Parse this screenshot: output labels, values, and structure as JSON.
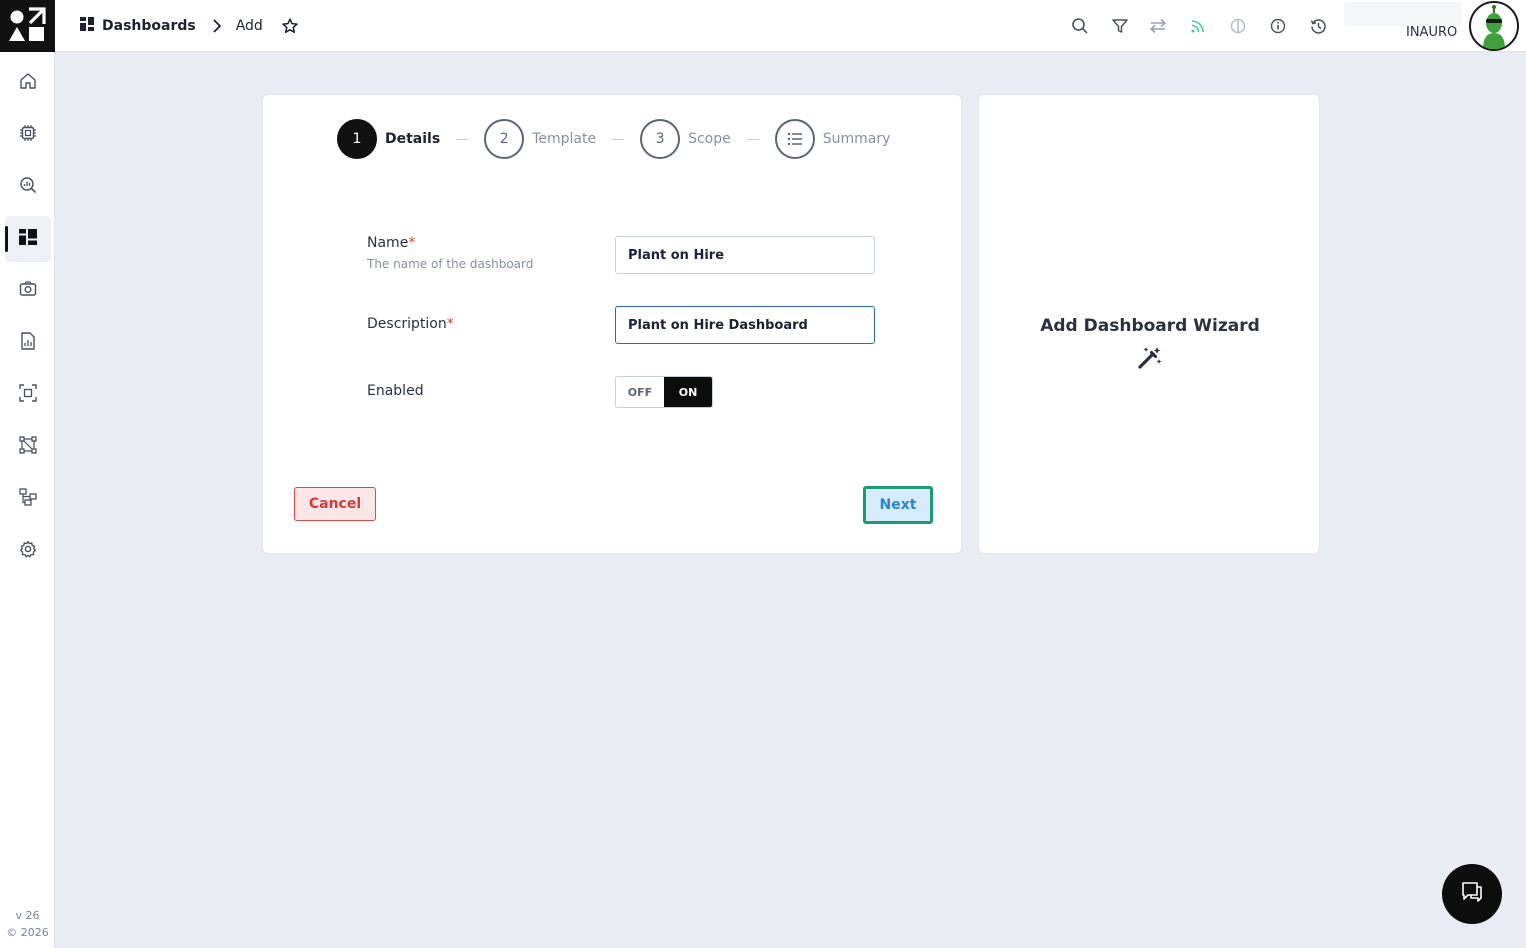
{
  "breadcrumb": {
    "root": "Dashboards",
    "current": "Add"
  },
  "topbar": {
    "tools": [
      "search-icon",
      "filter-icon",
      "swap-icon",
      "feed-icon",
      "theme-icon",
      "info-icon",
      "history-icon"
    ],
    "feed_color": "#3ecf8e",
    "user_name": "INAURO"
  },
  "sidebar": {
    "items": [
      "home-icon",
      "device-icon",
      "explore-icon",
      "dashboards-icon",
      "camera-icon",
      "report-icon",
      "scope-icon",
      "diagram-icon",
      "hierarchy-icon",
      "settings-icon"
    ],
    "active": "dashboards-icon",
    "version": "v 26",
    "copyright": "© 2026"
  },
  "wizard": {
    "steps": [
      {
        "number": "1",
        "label": "Details",
        "active": true
      },
      {
        "number": "2",
        "label": "Template",
        "active": false
      },
      {
        "number": "3",
        "label": "Scope",
        "active": false
      },
      {
        "number": "",
        "label": "Summary",
        "active": false
      }
    ],
    "form": {
      "name_label": "Name",
      "name_hint": "The name of the dashboard",
      "name_value": "Plant on Hire",
      "description_label": "Description",
      "description_value": "Plant on Hire Dashboard",
      "required_mark": "*",
      "enabled_label": "Enabled",
      "toggle_off": "OFF",
      "toggle_on": "ON",
      "enabled": true
    },
    "cancel_label": "Cancel",
    "next_label": "Next",
    "side_title": "Add Dashboard Wizard"
  },
  "colors": {
    "cancel": "#d33a3a",
    "next_border": "#1f9a70",
    "next_text": "#2b85c9"
  }
}
